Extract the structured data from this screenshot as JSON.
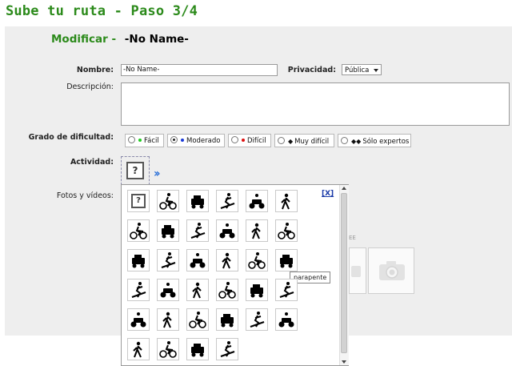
{
  "page": {
    "title": "Sube tu ruta - Paso 3/4"
  },
  "header": {
    "modify_label": "Modificar -",
    "route_name": "-No Name-"
  },
  "form": {
    "name_label": "Nombre:",
    "name_value": "-No Name-",
    "privacy_label": "Privacidad:",
    "privacy_value": "Pública",
    "description_label": "Descripción:",
    "difficulty_label": "Grado de dificultad:",
    "difficulty_options": [
      {
        "label": "Fácil",
        "color": "#22cc22",
        "selected": false
      },
      {
        "label": "Moderado",
        "color": "#1a3ad8",
        "selected": true
      },
      {
        "label": "Difícil",
        "color": "#dd1111",
        "selected": false
      },
      {
        "label": "Muy difícil",
        "selected": false
      },
      {
        "label": "Sólo expertos",
        "selected": false
      }
    ],
    "activity_label": "Actividad:",
    "activity_placeholder": "?",
    "media_label": "Fotos y vídeos:"
  },
  "activity_picker": {
    "close_label": "[X]",
    "tooltip": "parapente",
    "icons": [
      "unknown-activity-icon",
      "hiking-icon",
      "mountain-biking-icon",
      "4x4-icon",
      "skiing-icon",
      "quad-icon",
      "motocross-icon",
      "sailing-icon",
      "kayak-icon",
      "snowmobile-icon",
      "running-icon",
      "climbing-icon",
      "hang-gliding-icon",
      "hot-air-balloon-icon",
      "skating-icon",
      "snowboard-icon",
      "diving-icon",
      "paragliding-icon",
      "orienteering-icon",
      "canyoning-icon",
      "boat-icon",
      "horse-riding-icon",
      "caving-icon",
      "cycling-icon",
      "rollerblading-icon",
      "e-bike-icon",
      "dog-sledding-icon",
      "mountaineering-icon",
      "ice-climbing-icon",
      "family-walk-icon",
      "wheelchair-icon",
      "train-icon",
      "tree-climbing-icon",
      "bike-touring-icon"
    ]
  }
}
